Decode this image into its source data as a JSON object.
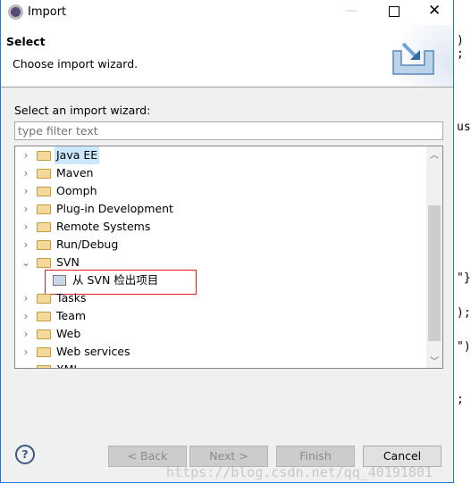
{
  "window": {
    "title": "Import"
  },
  "header": {
    "title": "Select",
    "subtitle": "Choose import wizard."
  },
  "body": {
    "prompt": "Select an import wizard:",
    "filter_placeholder": "type filter text"
  },
  "tree": [
    {
      "label": "Java EE",
      "expanded": false,
      "selected": true
    },
    {
      "label": "Maven",
      "expanded": false
    },
    {
      "label": "Oomph",
      "expanded": false
    },
    {
      "label": "Plug-in Development",
      "expanded": false
    },
    {
      "label": "Remote Systems",
      "expanded": false
    },
    {
      "label": "Run/Debug",
      "expanded": false
    },
    {
      "label": "SVN",
      "expanded": true,
      "children": [
        {
          "label": "从 SVN 检出项目",
          "highlighted": true
        }
      ]
    },
    {
      "label": "Tasks",
      "expanded": false
    },
    {
      "label": "Team",
      "expanded": false
    },
    {
      "label": "Web",
      "expanded": false
    },
    {
      "label": "Web services",
      "expanded": false
    },
    {
      "label": "XML",
      "expanded": false
    }
  ],
  "buttons": {
    "back": "< Back",
    "next": "Next >",
    "finish": "Finish",
    "cancel": "Cancel"
  },
  "background_code": [
    ") ;",
    "us",
    "\"}",
    ");",
    "\");",
    ";"
  ],
  "watermark": "https://blog.csdn.net/qq_40191801",
  "colors": {
    "accent": "#1e7ad6",
    "selection": "#cce8ff",
    "highlight_box": "#e02020"
  }
}
